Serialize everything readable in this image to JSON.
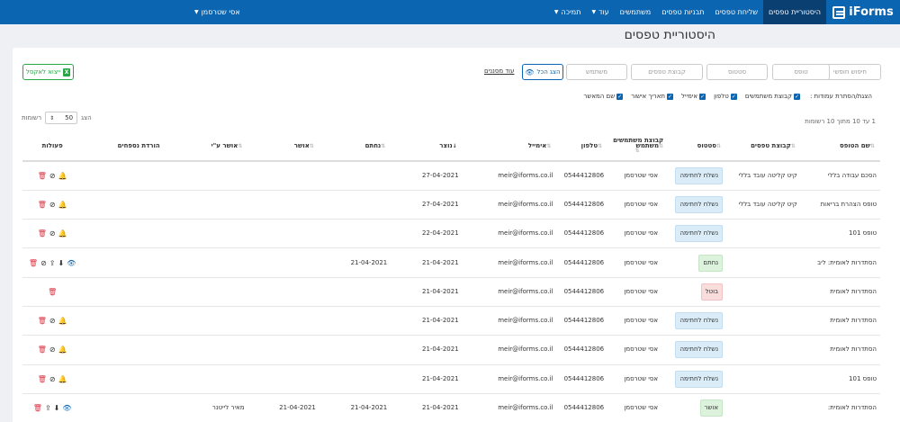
{
  "nav": {
    "brand": "iForms",
    "items": [
      {
        "label": "היסטוריית טפסים",
        "active": true,
        "caret": false
      },
      {
        "label": "שליחת טפסים",
        "active": false,
        "caret": false
      },
      {
        "label": "תבניות טפסים",
        "active": false,
        "caret": false
      },
      {
        "label": "משתמשים",
        "active": false,
        "caret": false
      },
      {
        "label": "עוד",
        "active": false,
        "caret": true
      },
      {
        "label": "תמיכה",
        "active": false,
        "caret": true
      }
    ],
    "user": "אסי שטרסמן"
  },
  "page_title": "היסטוריית טפסים",
  "filters": {
    "free_search": "חיפוש חופשי",
    "form": "טופס",
    "status": "סטטוס",
    "form_group": "קבוצת טפסים",
    "user": "משתמש",
    "show_all": "הצג הכל",
    "more_filters": "עוד מסננים",
    "export": "ייצוא לאקסל"
  },
  "column_toggles": {
    "label": "הצגת/הסתרת עמודות :",
    "items": [
      "קבוצת משתמשים",
      "טלפון",
      "אימייל",
      "תאריך אישור",
      "שם המאשר"
    ]
  },
  "results_info": "1 עד 10 מתוך 10 רשומות",
  "page_size": {
    "prefix": "הצג",
    "value": "50",
    "suffix": "רשומות"
  },
  "table": {
    "headers": {
      "form_name": "שם הטופס",
      "form_group": "קבוצת טפסים",
      "status": "סטטוס",
      "user": "משתמש",
      "user_group": "קבוצת משתמשים",
      "phone": "טלפון",
      "email": "אימייל",
      "created": "נוצר",
      "signed": "נחתם",
      "approver": "אושר",
      "approved_by": "אושר ע\"י",
      "attachments": "הורדת נספחים",
      "actions": "פעולות"
    },
    "rows": [
      {
        "form_name": "הסכם עבודה בללי",
        "form_group": "קיט קליטה עובד בללי",
        "status": "נשלח לחתימה",
        "status_type": "sent",
        "user": "אסי שטרסמן",
        "phone": "0544412806",
        "email": "meir@iforms.co.il",
        "created": "27-04-2021",
        "signed": "",
        "approved": "",
        "approved_by": "",
        "actions": [
          "bell",
          "ban",
          "trash"
        ]
      },
      {
        "form_name": "טופס הצהרת בריאות",
        "form_group": "קיט קליטה עובד בללי",
        "status": "נשלח לחתימה",
        "status_type": "sent",
        "user": "אסי שטרסמן",
        "phone": "0544412806",
        "email": "meir@iforms.co.il",
        "created": "27-04-2021",
        "signed": "",
        "approved": "",
        "approved_by": "",
        "actions": [
          "bell",
          "ban",
          "trash"
        ]
      },
      {
        "form_name": "טופס 101",
        "form_group": "",
        "status": "נשלח לחתימה",
        "status_type": "sent",
        "user": "אסי שטרסמן",
        "phone": "0544412806",
        "email": "meir@iforms.co.il",
        "created": "22-04-2021",
        "signed": "",
        "approved": "",
        "approved_by": "",
        "actions": [
          "bell",
          "ban",
          "trash"
        ]
      },
      {
        "form_name": "הסתדרות לאומית: ליב",
        "form_group": "",
        "status": "נחתם",
        "status_type": "signed",
        "user": "אסי שטרסמן",
        "phone": "0544412806",
        "email": "meir@iforms.co.il",
        "created": "21-04-2021",
        "signed": "21-04-2021",
        "approved": "",
        "approved_by": "",
        "actions": [
          "eye",
          "down",
          "share",
          "ban",
          "trash"
        ]
      },
      {
        "form_name": "הסתדרות לאומית",
        "form_group": "",
        "status": "בוטל",
        "status_type": "cancelled",
        "user": "אסי שטרסמן",
        "phone": "0544412806",
        "email": "meir@iforms.co.il",
        "created": "21-04-2021",
        "signed": "",
        "approved": "",
        "approved_by": "",
        "actions": [
          "trash"
        ]
      },
      {
        "form_name": "הסתדרות לאומית",
        "form_group": "",
        "status": "נשלח לחתימה",
        "status_type": "sent",
        "user": "אסי שטרסמן",
        "phone": "0544412806",
        "email": "meir@iforms.co.il",
        "created": "21-04-2021",
        "signed": "",
        "approved": "",
        "approved_by": "",
        "actions": [
          "bell",
          "ban",
          "trash"
        ]
      },
      {
        "form_name": "הסתדרות לאומית",
        "form_group": "",
        "status": "נשלח לחתימה",
        "status_type": "sent",
        "user": "אסי שטרסמן",
        "phone": "0544412806",
        "email": "meir@iforms.co.il",
        "created": "21-04-2021",
        "signed": "",
        "approved": "",
        "approved_by": "",
        "actions": [
          "bell",
          "ban",
          "trash"
        ]
      },
      {
        "form_name": "טופס 101",
        "form_group": "",
        "status": "נשלח לחתימה",
        "status_type": "sent",
        "user": "אסי שטרסמן",
        "phone": "0544412806",
        "email": "meir@iforms.co.il",
        "created": "21-04-2021",
        "signed": "",
        "approved": "",
        "approved_by": "",
        "actions": [
          "bell",
          "ban",
          "trash"
        ]
      },
      {
        "form_name": "הסתדרות לאומית:",
        "form_group": "",
        "status": "אושר",
        "status_type": "approved",
        "user": "אסי שטרסמן",
        "phone": "0544412806",
        "email": "meir@iforms.co.il",
        "created": "21-04-2021",
        "signed": "21-04-2021",
        "approved": "21-04-2021",
        "approved_by": "מאיר לייטנר",
        "actions": [
          "eye",
          "down",
          "share",
          "trash"
        ]
      }
    ]
  },
  "icons": {
    "bell": "bell-icon",
    "ban": "ban-icon",
    "trash": "trash-icon",
    "eye": "eye-icon",
    "down": "download-icon",
    "share": "share-icon"
  },
  "colors": {
    "nav": "#0b65b0",
    "nav_active": "#0a3f72",
    "export_green": "#28a745",
    "trash_red": "#dc3545"
  }
}
